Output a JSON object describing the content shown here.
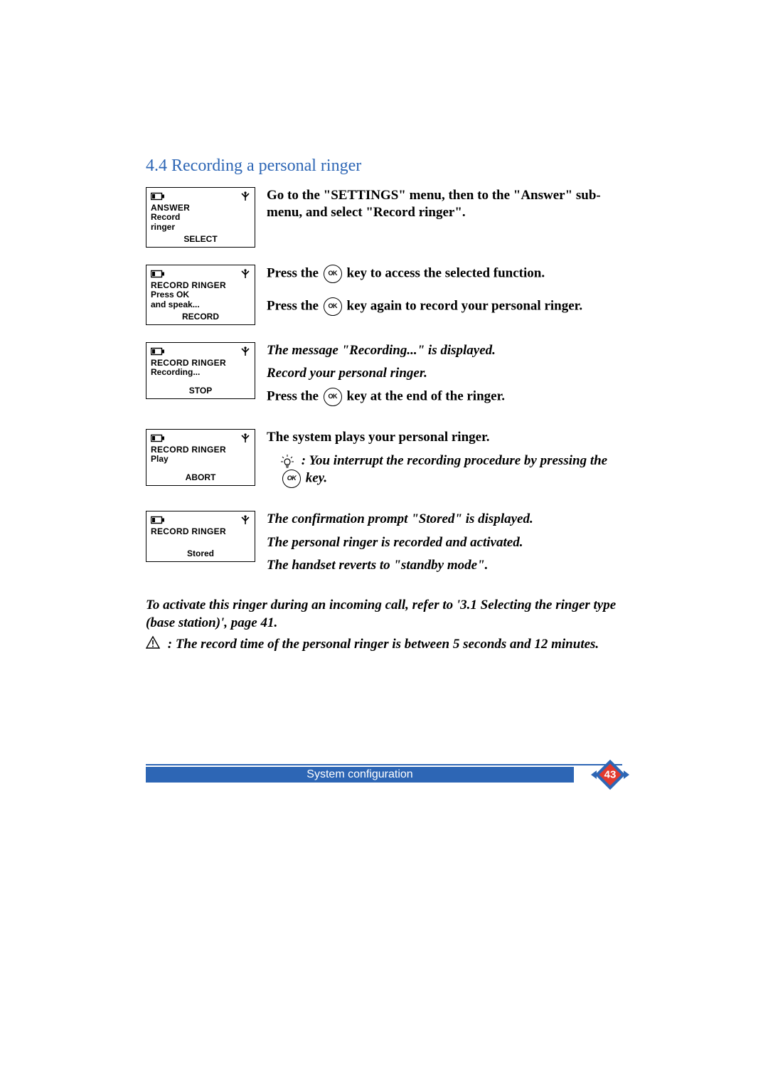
{
  "heading": "4.4 Recording a personal ringer",
  "ok_label": "OK",
  "screens": {
    "s1": {
      "title": "ANSWER",
      "line1": "Record",
      "line2": "ringer",
      "softkey": "SELECT"
    },
    "s2": {
      "title": "RECORD RINGER",
      "line1": "Press OK",
      "line2": "and speak...",
      "softkey": "RECORD"
    },
    "s3": {
      "title": "RECORD RINGER",
      "line1": "Recording...",
      "softkey": "STOP"
    },
    "s4": {
      "title": "RECORD RINGER",
      "line1": "Play",
      "softkey": "ABORT"
    },
    "s5": {
      "title": "RECORD RINGER",
      "line1": "Stored"
    }
  },
  "steps": {
    "t1": "Go to the \"SETTINGS\" menu, then to the \"Answer\" sub-menu, and select  \"Record ringer\".",
    "t2a_before": "Press the ",
    "t2a_after": " key to access the selected function.",
    "t2b_before": "Press the ",
    "t2b_after": " key again to record your personal ringer.",
    "t3a": "The message \"Recording...\" is displayed.",
    "t3b": "Record your personal ringer.",
    "t3c_before": "Press the ",
    "t3c_after": " key at the end of the ringer.",
    "t4a": "The system plays your personal ringer.",
    "t4b_before": "  :  You interrupt the recording procedure by pressing the ",
    "t4b_after": " key.",
    "t5a": "The confirmation prompt \"Stored\" is displayed.",
    "t5b": "The personal ringer is recorded and activated.",
    "t5c": "The handset reverts to \"standby mode\"."
  },
  "footnote": {
    "ref_before": "To activate this ringer during an incoming call, refer to",
    "ref_mid": " '3.1 Selecting the ringer type (base station)', page 41.",
    "warn": "  :  The record time of the personal ringer is between 5 seconds and 12 minutes."
  },
  "footer": {
    "section": "System configuration",
    "page": "43"
  }
}
